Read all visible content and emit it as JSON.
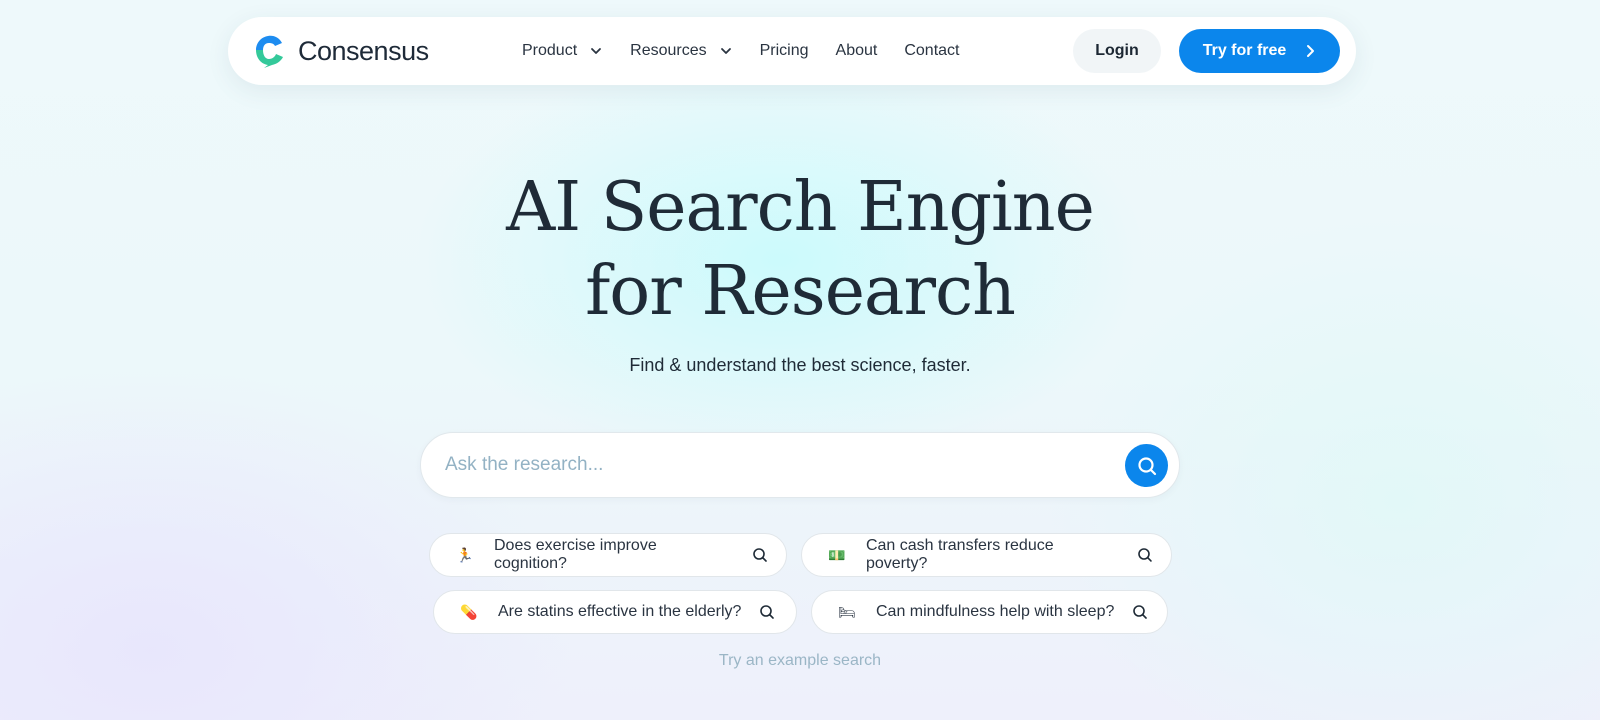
{
  "brand": {
    "name": "Consensus",
    "logo_colors": {
      "top": "#1d8cf0",
      "bottom": "#34c99a"
    }
  },
  "nav": {
    "items": [
      {
        "label": "Product",
        "has_dropdown": true
      },
      {
        "label": "Resources",
        "has_dropdown": true
      },
      {
        "label": "Pricing",
        "has_dropdown": false
      },
      {
        "label": "About",
        "has_dropdown": false
      },
      {
        "label": "Contact",
        "has_dropdown": false
      }
    ],
    "login_label": "Login",
    "cta_label": "Try for free"
  },
  "hero": {
    "title_line1": "AI Search Engine",
    "title_line2": "for Research",
    "subtitle": "Find & understand the best science, faster."
  },
  "search": {
    "placeholder": "Ask the research...",
    "value": "",
    "button_icon": "search-icon"
  },
  "examples": {
    "label": "Try an example search",
    "items": [
      {
        "emoji": "🏃",
        "emoji_name": "running-person-icon",
        "text": "Does exercise improve cognition?"
      },
      {
        "emoji": "💵",
        "emoji_name": "money-icon",
        "text": "Can cash transfers reduce poverty?"
      },
      {
        "emoji": "💊",
        "emoji_name": "pill-icon",
        "text": "Are statins effective in the elderly?"
      },
      {
        "emoji": "🛏",
        "emoji_name": "bed-icon",
        "text": "Can mindfulness help with sleep?"
      }
    ]
  },
  "colors": {
    "accent": "#0b86ec",
    "text": "#1f2b37",
    "muted": "#9bb6c6"
  }
}
